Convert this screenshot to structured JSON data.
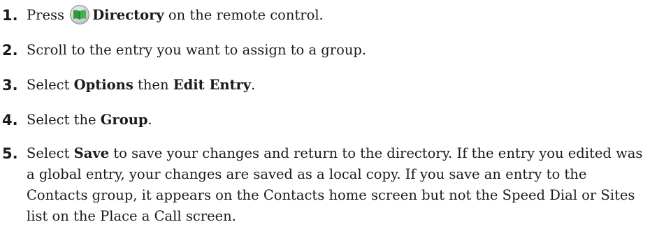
{
  "steps": [
    {
      "number": "1.",
      "before": "Press ",
      "icon": "directory-book-icon",
      "bold": "Directory",
      "after": " on the remote control."
    },
    {
      "number": "2.",
      "text": "Scroll to the entry you want to assign to a group."
    },
    {
      "number": "3.",
      "before": "Select ",
      "bold1": "Options",
      "middle": " then ",
      "bold2": "Edit Entry",
      "after": "."
    },
    {
      "number": "4.",
      "before": "Select the ",
      "bold": "Group",
      "after": "."
    },
    {
      "number": "5.",
      "before": "Select ",
      "bold": "Save",
      "after": " to save your changes and return to the directory. If the entry you edited was a global entry, your changes are saved as a local copy. If you save an entry to the Contacts group, it appears on the Contacts home screen but not the Speed Dial or Sites list on the Place a Call screen."
    }
  ],
  "colors": {
    "text": "#1a1a1a",
    "icon_green": "#2e9a3a",
    "icon_ring": "#cfcfcf"
  }
}
